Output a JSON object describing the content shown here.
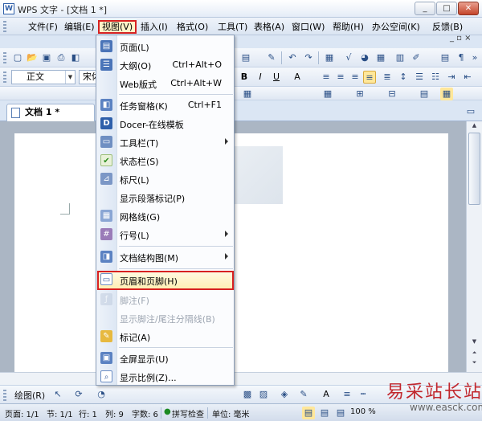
{
  "window": {
    "title": "WPS 文字 - [文档 1 *]",
    "app_icon": "W"
  },
  "menubar": {
    "items": [
      {
        "label": "文件(F)"
      },
      {
        "label": "编辑(E)"
      },
      {
        "label": "视图(V)",
        "active": true
      },
      {
        "label": "插入(I)"
      },
      {
        "label": "格式(O)"
      },
      {
        "label": "工具(T)"
      },
      {
        "label": "表格(A)"
      },
      {
        "label": "窗口(W)"
      },
      {
        "label": "帮助(H)"
      },
      {
        "label": "办公空间(K)"
      },
      {
        "label": "反馈(B)"
      }
    ]
  },
  "format_toolbar": {
    "style_value": "正文",
    "font_value": "宋体"
  },
  "document_tabs": [
    {
      "label": "文档 1 *"
    }
  ],
  "view_menu": {
    "items": [
      {
        "icon": "page-view-icon",
        "label": "页面(L)",
        "shortcut": ""
      },
      {
        "icon": "outline-icon",
        "label": "大纲(O)",
        "shortcut": "Ctrl+Alt+O"
      },
      {
        "icon": "",
        "label": "Web版式",
        "shortcut": "Ctrl+Alt+W"
      },
      {
        "icon": "task-pane-icon",
        "label": "任务窗格(K)",
        "shortcut": "Ctrl+F1"
      },
      {
        "icon": "docer-icon",
        "label": "Docer-在线模板",
        "shortcut": ""
      },
      {
        "icon": "toolbar-icon",
        "label": "工具栏(T)",
        "shortcut": "",
        "submenu": true
      },
      {
        "icon": "status-bar-check-icon",
        "label": "状态栏(S)",
        "shortcut": ""
      },
      {
        "icon": "ruler-icon",
        "label": "标尺(L)",
        "shortcut": ""
      },
      {
        "icon": "",
        "label": "显示段落标记(P)",
        "shortcut": ""
      },
      {
        "icon": "gridlines-icon",
        "label": "网格线(G)",
        "shortcut": ""
      },
      {
        "icon": "line-number-icon",
        "label": "行号(L)",
        "shortcut": "",
        "submenu": true
      },
      {
        "icon": "document-map-icon",
        "label": "文档结构图(M)",
        "shortcut": "",
        "submenu": true
      },
      {
        "icon": "header-footer-icon",
        "label": "页眉和页脚(H)",
        "shortcut": "",
        "highlight": true
      },
      {
        "icon": "footnote-icon",
        "label": "脚注(F)",
        "shortcut": "",
        "disabled": true
      },
      {
        "icon": "",
        "label": "显示脚注/尾注分隔线(B)",
        "shortcut": "",
        "disabled": true
      },
      {
        "icon": "bookmark-icon",
        "label": "标记(A)",
        "shortcut": ""
      },
      {
        "icon": "full-screen-icon",
        "label": "全屏显示(U)",
        "shortcut": ""
      },
      {
        "icon": "zoom-icon",
        "label": "显示比例(Z)...",
        "shortcut": ""
      }
    ]
  },
  "drawing_toolbar": {
    "draw_label": "绘图(R)"
  },
  "statusbar": {
    "page": "页面: 1/1",
    "section": "节: 1/1",
    "line": "行: 1",
    "column": "列: 9",
    "word_count": "字数: 6",
    "spell_check": "拼写检查",
    "unit": "单位: 毫米",
    "zoom": "100 %"
  },
  "watermark": {
    "title": "易采站长站",
    "url": "www.easck.com"
  }
}
